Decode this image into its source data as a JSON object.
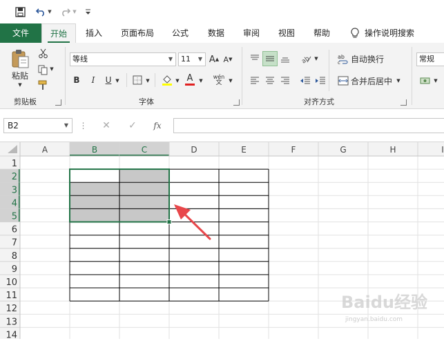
{
  "quick_access": {
    "icons": [
      "save-icon",
      "undo-icon",
      "redo-icon",
      "customize-icon"
    ]
  },
  "tabs": [
    {
      "label": "文件",
      "active": false
    },
    {
      "label": "开始",
      "active": true
    },
    {
      "label": "插入",
      "active": false
    },
    {
      "label": "页面布局",
      "active": false
    },
    {
      "label": "公式",
      "active": false
    },
    {
      "label": "数据",
      "active": false
    },
    {
      "label": "审阅",
      "active": false
    },
    {
      "label": "视图",
      "active": false
    },
    {
      "label": "帮助",
      "active": false
    }
  ],
  "tell_me": "操作说明搜索",
  "ribbon": {
    "clipboard": {
      "paste_label": "粘贴",
      "group_label": "剪贴板"
    },
    "font": {
      "font_name": "等线",
      "font_size": "11",
      "bold": "B",
      "italic": "I",
      "underline": "U",
      "grow": "A",
      "shrink": "A",
      "font_color": "A",
      "phonetic": "wén",
      "group_label": "字体"
    },
    "alignment": {
      "wrap_text": "自动换行",
      "merge_center": "合并后居中",
      "group_label": "对齐方式"
    },
    "number": {
      "format": "常规"
    }
  },
  "formula_bar": {
    "name_box": "B2",
    "fx": "fx",
    "cancel": "✕",
    "enter": "✓",
    "formula": ""
  },
  "sheet": {
    "columns": [
      "A",
      "B",
      "C",
      "D",
      "E",
      "F",
      "G",
      "H",
      "I"
    ],
    "rows": [
      "1",
      "2",
      "3",
      "4",
      "5",
      "6",
      "7",
      "8",
      "9",
      "10",
      "11",
      "12",
      "13",
      "14"
    ],
    "active_cell": "B2",
    "selected_range": "B2:C5",
    "selection_color": "#217346",
    "fill_color": "#c8c8c8"
  },
  "watermark": {
    "text": "Baidu经验",
    "sub": "jingyan.baidu.com"
  },
  "annotation": {
    "arrow_color": "#e8474b"
  }
}
